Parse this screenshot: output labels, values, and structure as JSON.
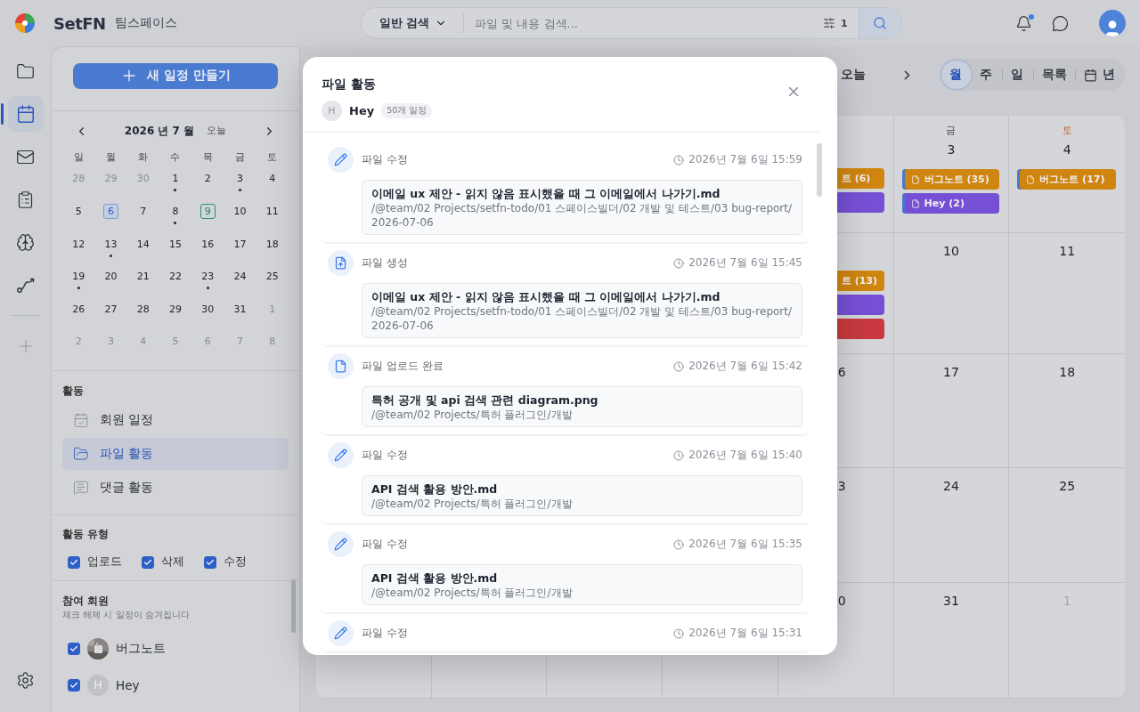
{
  "topbar": {
    "brand": "SetFN",
    "workspace": "팀스페이스",
    "search": {
      "scope": "일반 검색",
      "placeholder": "파일 및 내용 검색...",
      "filter_count": "1"
    },
    "notifications": {
      "unread": true
    }
  },
  "rail": {
    "items": [
      {
        "kind": "folder",
        "selected": false
      },
      {
        "kind": "calendar",
        "selected": true
      },
      {
        "kind": "mail",
        "selected": false
      },
      {
        "kind": "clipboard",
        "selected": false
      },
      {
        "kind": "brain",
        "selected": false
      },
      {
        "kind": "route",
        "selected": false
      }
    ]
  },
  "sidebar": {
    "new_button": "새 일정 만들기",
    "mini_calendar": {
      "title": "2026 년 7 월",
      "today": "오늘",
      "weekdays": [
        "일",
        "월",
        "화",
        "수",
        "목",
        "금",
        "토"
      ],
      "weeks": [
        [
          {
            "day": "28",
            "outside": true,
            "selected": false,
            "today": false,
            "dot": false
          },
          {
            "day": "29",
            "outside": true,
            "selected": false,
            "today": false,
            "dot": false
          },
          {
            "day": "30",
            "outside": true,
            "selected": false,
            "today": false,
            "dot": false
          },
          {
            "day": "1",
            "outside": false,
            "selected": false,
            "today": false,
            "dot": true
          },
          {
            "day": "2",
            "outside": false,
            "selected": false,
            "today": false,
            "dot": false
          },
          {
            "day": "3",
            "outside": false,
            "selected": false,
            "today": false,
            "dot": true
          },
          {
            "day": "4",
            "outside": false,
            "selected": false,
            "today": false,
            "dot": false
          }
        ],
        [
          {
            "day": "5",
            "outside": false,
            "selected": false,
            "today": false,
            "dot": false
          },
          {
            "day": "6",
            "outside": false,
            "selected": true,
            "today": false,
            "dot": false
          },
          {
            "day": "7",
            "outside": false,
            "selected": false,
            "today": false,
            "dot": false
          },
          {
            "day": "8",
            "outside": false,
            "selected": false,
            "today": false,
            "dot": true
          },
          {
            "day": "9",
            "outside": false,
            "selected": false,
            "today": true,
            "dot": false
          },
          {
            "day": "10",
            "outside": false,
            "selected": false,
            "today": false,
            "dot": false
          },
          {
            "day": "11",
            "outside": false,
            "selected": false,
            "today": false,
            "dot": false
          }
        ],
        [
          {
            "day": "12",
            "outside": false,
            "selected": false,
            "today": false,
            "dot": false
          },
          {
            "day": "13",
            "outside": false,
            "selected": false,
            "today": false,
            "dot": true
          },
          {
            "day": "14",
            "outside": false,
            "selected": false,
            "today": false,
            "dot": false
          },
          {
            "day": "15",
            "outside": false,
            "selected": false,
            "today": false,
            "dot": false
          },
          {
            "day": "16",
            "outside": false,
            "selected": false,
            "today": false,
            "dot": false
          },
          {
            "day": "17",
            "outside": false,
            "selected": false,
            "today": false,
            "dot": false
          },
          {
            "day": "18",
            "outside": false,
            "selected": false,
            "today": false,
            "dot": false
          }
        ],
        [
          {
            "day": "19",
            "outside": false,
            "selected": false,
            "today": false,
            "dot": true
          },
          {
            "day": "20",
            "outside": false,
            "selected": false,
            "today": false,
            "dot": false
          },
          {
            "day": "21",
            "outside": false,
            "selected": false,
            "today": false,
            "dot": false
          },
          {
            "day": "22",
            "outside": false,
            "selected": false,
            "today": false,
            "dot": false
          },
          {
            "day": "23",
            "outside": false,
            "selected": false,
            "today": false,
            "dot": true
          },
          {
            "day": "24",
            "outside": false,
            "selected": false,
            "today": false,
            "dot": false
          },
          {
            "day": "25",
            "outside": false,
            "selected": false,
            "today": false,
            "dot": false
          }
        ],
        [
          {
            "day": "26",
            "outside": false,
            "selected": false,
            "today": false,
            "dot": false
          },
          {
            "day": "27",
            "outside": false,
            "selected": false,
            "today": false,
            "dot": false
          },
          {
            "day": "28",
            "outside": false,
            "selected": false,
            "today": false,
            "dot": false
          },
          {
            "day": "29",
            "outside": false,
            "selected": false,
            "today": false,
            "dot": false
          },
          {
            "day": "30",
            "outside": false,
            "selected": false,
            "today": false,
            "dot": false
          },
          {
            "day": "31",
            "outside": false,
            "selected": false,
            "today": false,
            "dot": false
          },
          {
            "day": "1",
            "outside": true,
            "selected": false,
            "today": false,
            "dot": false
          }
        ],
        [
          {
            "day": "2",
            "outside": true,
            "selected": false,
            "today": false,
            "dot": false
          },
          {
            "day": "3",
            "outside": true,
            "selected": false,
            "today": false,
            "dot": false
          },
          {
            "day": "4",
            "outside": true,
            "selected": false,
            "today": false,
            "dot": false
          },
          {
            "day": "5",
            "outside": true,
            "selected": false,
            "today": false,
            "dot": false
          },
          {
            "day": "6",
            "outside": true,
            "selected": false,
            "today": false,
            "dot": false
          },
          {
            "day": "7",
            "outside": true,
            "selected": false,
            "today": false,
            "dot": false
          },
          {
            "day": "8",
            "outside": true,
            "selected": false,
            "today": false,
            "dot": false
          }
        ]
      ]
    },
    "activity": {
      "title": "활동",
      "items": [
        {
          "kind": "member",
          "label": "회원 일정",
          "selected": false
        },
        {
          "kind": "file",
          "label": "파일 활동",
          "selected": true
        },
        {
          "kind": "comment",
          "label": "댓글 활동",
          "selected": false
        }
      ]
    },
    "activity_types": {
      "title": "활동 유형",
      "options": [
        {
          "label": "업로드",
          "checked": true
        },
        {
          "label": "삭제",
          "checked": true
        },
        {
          "label": "수정",
          "checked": true
        }
      ]
    },
    "members": {
      "title": "참여 회원",
      "hint": "체크 해제 시 일정이 숨겨집니다",
      "items": [
        {
          "name": "버그노트",
          "checked": true
        },
        {
          "name": "Hey",
          "checked": true,
          "kind": "initial",
          "initial": "H"
        }
      ]
    }
  },
  "calendar": {
    "today": "오늘",
    "views": [
      {
        "label": "월",
        "selected": true,
        "kind": "plain"
      },
      {
        "label": "주",
        "selected": false,
        "kind": "plain"
      },
      {
        "label": "일",
        "selected": false,
        "kind": "plain"
      },
      {
        "label": "목록",
        "selected": false,
        "kind": "plain"
      },
      {
        "label": "년",
        "selected": false,
        "kind": "icon"
      }
    ],
    "weeks": [
      {
        "cells": [
          {
            "kind": "partial",
            "events": [
              {
                "label": "트 (6)",
                "color": "#cf850f"
              },
              {
                "color": "#7650d4"
              }
            ]
          },
          {
            "kind": "full",
            "weekday": "금",
            "date": "3",
            "events": [
              {
                "label": "버그노트 (35)",
                "color": "#cf850f"
              },
              {
                "label": "Hey (2)",
                "color": "#7650d4"
              }
            ]
          },
          {
            "kind": "full",
            "weekday": "토",
            "weekend": true,
            "date": "4",
            "events": [
              {
                "label": "버그노트 (17)",
                "color": "#cf850f"
              }
            ]
          }
        ]
      },
      {
        "cells": [
          {
            "kind": "partial",
            "events": [
              {
                "label": "트 (13)",
                "color": "#cf850f"
              },
              {
                "color": "#7650d4"
              },
              {
                "color": "#c83a3f"
              }
            ]
          },
          {
            "kind": "full",
            "date": "10"
          },
          {
            "kind": "full",
            "date": "11"
          }
        ]
      },
      {
        "cells": [
          {
            "kind": "partial",
            "date": "6"
          },
          {
            "kind": "full",
            "date": "17"
          },
          {
            "kind": "full",
            "date": "18"
          }
        ]
      },
      {
        "cells": [
          {
            "kind": "partial",
            "date": "3"
          },
          {
            "kind": "full",
            "date": "24"
          },
          {
            "kind": "full",
            "date": "25"
          }
        ]
      },
      {
        "cells": [
          {
            "kind": "partial",
            "date": "0"
          },
          {
            "kind": "full",
            "date": "31"
          },
          {
            "kind": "outside",
            "date": "1"
          }
        ]
      }
    ]
  },
  "modal": {
    "title": "파일 활동",
    "user": {
      "initial": "H",
      "name": "Hey",
      "count": "50개 일정"
    },
    "items": [
      {
        "kind": "edit",
        "action": "파일 수정",
        "time": "2026년 7월 6일 15:59",
        "file": {
          "name": "이메일 ux 제안 - 읽지 않음 표시했을 때 그 이메일에서 나가기.md",
          "path": "/@team/02 Projects/setfn-todo/01 스페이스빌더/02 개발 및 테스트/03 bug-report/2026-07-06"
        }
      },
      {
        "kind": "create",
        "action": "파일 생성",
        "time": "2026년 7월 6일 15:45",
        "file": {
          "name": "이메일 ux 제안 - 읽지 않음 표시했을 때 그 이메일에서 나가기.md",
          "path": "/@team/02 Projects/setfn-todo/01 스페이스빌더/02 개발 및 테스트/03 bug-report/2026-07-06"
        }
      },
      {
        "kind": "upload",
        "action": "파일 업로드 완료",
        "time": "2026년 7월 6일 15:42",
        "file": {
          "name": "특허 공개 및 api 검색 관련 diagram.png",
          "path": "/@team/02 Projects/특허 플러그인/개발"
        }
      },
      {
        "kind": "edit",
        "action": "파일 수정",
        "time": "2026년 7월 6일 15:40",
        "file": {
          "name": "API 검색 활용 방안.md",
          "path": "/@team/02 Projects/특허 플러그인/개발"
        }
      },
      {
        "kind": "edit",
        "action": "파일 수정",
        "time": "2026년 7월 6일 15:35",
        "file": {
          "name": "API 검색 활용 방안.md",
          "path": "/@team/02 Projects/특허 플러그인/개발"
        }
      },
      {
        "kind": "edit",
        "action": "파일 수정",
        "time": "2026년 7월 6일 15:31"
      }
    ]
  }
}
